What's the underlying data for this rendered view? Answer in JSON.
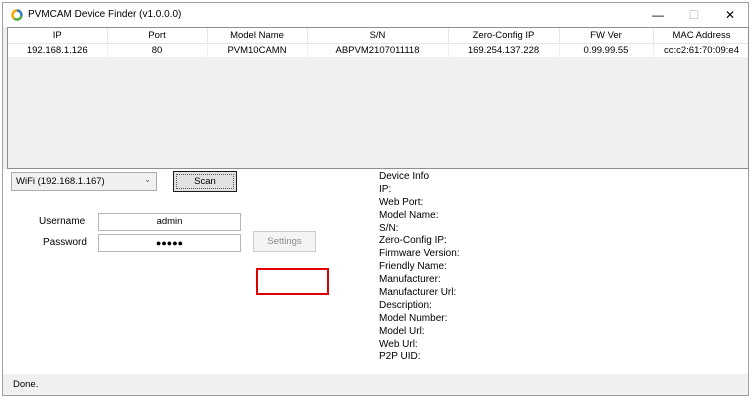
{
  "window": {
    "title": "PVMCAM Device Finder (v1.0.0.0)",
    "controls": {
      "minimize": "—",
      "maximize": "☐",
      "close": "✕"
    },
    "icon": "app-ring-icon",
    "accent_colors": [
      "#f7a600",
      "#2a7fd4",
      "#48b04a"
    ]
  },
  "table": {
    "columns": [
      "IP",
      "Port",
      "Model Name",
      "S/N",
      "Zero-Config IP",
      "FW Ver",
      "MAC Address"
    ],
    "rows": [
      [
        "192.168.1.126",
        "80",
        "PVM10CAMN",
        "ABPVM2107011118",
        "169.254.137.228",
        "0.99.99.55",
        "cc:c2:61:70:09:e4"
      ]
    ]
  },
  "controls": {
    "network_select": "WiFi (192.168.1.167)",
    "scan_label": "Scan",
    "username_label": "Username",
    "username_value": "admin",
    "password_label": "Password",
    "password_value": "●●●●●",
    "settings_label": "Settings"
  },
  "device_info": {
    "lines": [
      "Device Info",
      "IP:",
      "Web Port:",
      "Model Name:",
      "S/N:",
      "Zero-Config IP:",
      "Firmware Version:",
      "Friendly Name:",
      "Manufacturer:",
      "Manufacturer Url:",
      "Description:",
      "Model Number:",
      "Model Url:",
      "Web Url:",
      "P2P UID:"
    ]
  },
  "status": {
    "text": "Done."
  },
  "highlight_color": "#e10000"
}
